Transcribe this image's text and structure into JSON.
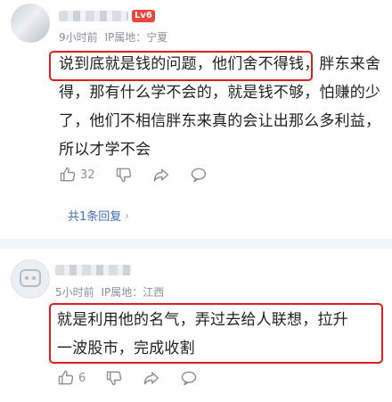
{
  "comments": [
    {
      "level_badge": "Lv6",
      "time": "9小时前",
      "ip_label": "IP属地：宁夏",
      "text": "说到底就是钱的问题，他们舍不得钱，胖东来舍得，那有什么学不会的，就是钱不够，怕赚的少了，他们不相信胖东来真的会让出那么多利益，所以才学不会",
      "likes": "32",
      "reply_count_label": "共1条回复"
    },
    {
      "time": "5小时前",
      "ip_label": "IP属地：江西",
      "text": "就是利用他的名气，弄过去给人联想，拉升一波股市，完成收割",
      "likes": "6"
    }
  ],
  "colors": {
    "highlight_box": "#e02020",
    "link": "#3e6fb3",
    "meta": "#8a8f99",
    "badge": "#e8453c"
  },
  "icons": [
    "thumbs-up-icon",
    "thumbs-down-icon",
    "share-icon",
    "comment-icon",
    "chevron-right-icon"
  ]
}
